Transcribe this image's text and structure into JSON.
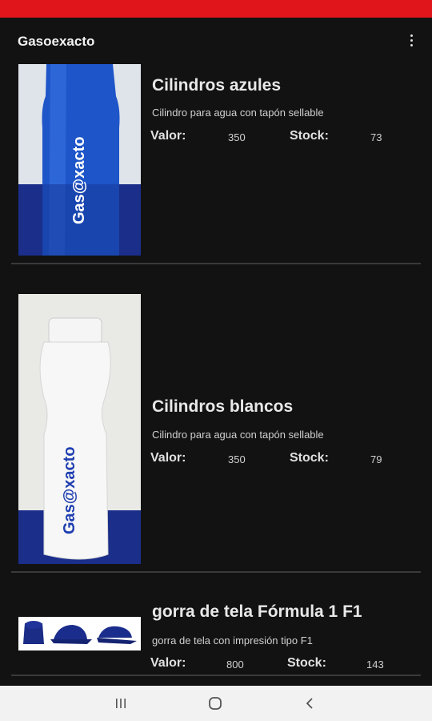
{
  "app": {
    "title": "Gasoexacto"
  },
  "labels": {
    "valor": "Valor:",
    "stock": "Stock:"
  },
  "products": [
    {
      "name": "Cilindros azules",
      "description": "Cilindro para agua con tapón sellable",
      "valor": "350",
      "stock": "73",
      "image_label": "Gas@xacto"
    },
    {
      "name": "Cilindros blancos",
      "description": "Cilindro para agua con tapón sellable",
      "valor": "350",
      "stock": "79",
      "image_label": "Gas@xacto"
    },
    {
      "name": "gorra de tela Fórmula 1 F1",
      "description": "gorra de tela con impresión tipo F1",
      "valor": "800",
      "stock": "143"
    }
  ],
  "colors": {
    "status_bar": "#e0151b",
    "background": "#121212",
    "nav_bar": "#f2f2f2",
    "brand_blue": "#1f3fb0"
  }
}
